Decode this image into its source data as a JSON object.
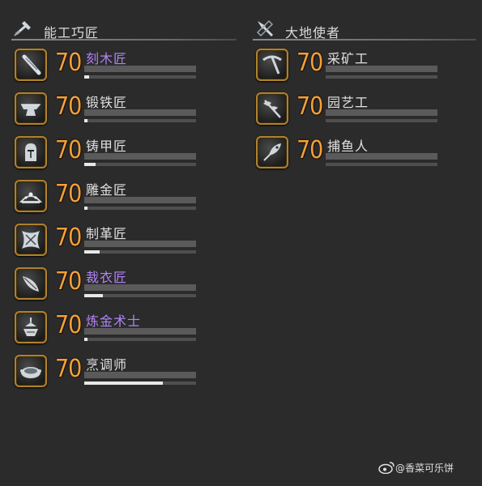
{
  "crafting": {
    "title": "能工巧匠",
    "icon": "hammer-icon",
    "jobs": [
      {
        "level": "70",
        "name": "刻木匠",
        "highlight": true,
        "icon": "carpenter-saw-icon",
        "exp_progress": 0.04
      },
      {
        "level": "70",
        "name": "锻铁匠",
        "highlight": false,
        "icon": "anvil-icon",
        "exp_progress": 0.03
      },
      {
        "level": "70",
        "name": "铸甲匠",
        "highlight": false,
        "icon": "helmet-icon",
        "exp_progress": 0.1
      },
      {
        "level": "70",
        "name": "雕金匠",
        "highlight": false,
        "icon": "tiara-icon",
        "exp_progress": 0.03
      },
      {
        "level": "70",
        "name": "制革匠",
        "highlight": false,
        "icon": "leather-icon",
        "exp_progress": 0.14
      },
      {
        "level": "70",
        "name": "裁衣匠",
        "highlight": true,
        "icon": "needle-icon",
        "exp_progress": 0.17
      },
      {
        "level": "70",
        "name": "炼金术士",
        "highlight": true,
        "icon": "alembic-icon",
        "exp_progress": 0.03
      },
      {
        "level": "70",
        "name": "烹调师",
        "highlight": false,
        "icon": "pot-icon",
        "exp_progress": 0.7
      }
    ]
  },
  "gathering": {
    "title": "大地使者",
    "icon": "gathering-tool-icon",
    "jobs": [
      {
        "level": "70",
        "name": "采矿工",
        "highlight": false,
        "icon": "pickaxe-icon",
        "exp_progress": 0.0
      },
      {
        "level": "70",
        "name": "园艺工",
        "highlight": false,
        "icon": "hatchet-icon",
        "exp_progress": 0.0
      },
      {
        "level": "70",
        "name": "捕鱼人",
        "highlight": false,
        "icon": "fishing-lure-icon",
        "exp_progress": 0.0
      }
    ]
  },
  "watermark": {
    "text": "@香菜可乐饼",
    "icon": "weibo-icon"
  },
  "colors": {
    "level": "#f3a03a",
    "highlight_name": "#b084f5",
    "frame": "#b0822a"
  }
}
